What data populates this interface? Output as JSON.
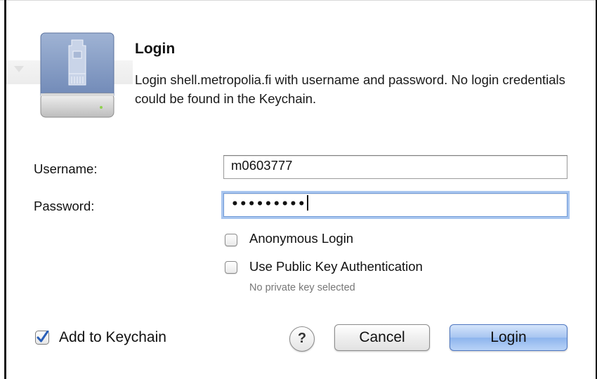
{
  "dialog": {
    "title": "Login",
    "description": "Login shell.metropolia.fi with username and password. No login credentials could be found in the Keychain.",
    "icon": "network-drive-icon"
  },
  "form": {
    "username_label": "Username:",
    "username_value": "m0603777",
    "password_label": "Password:",
    "password_masked": "•••••••••",
    "anonymous_label": "Anonymous Login",
    "anonymous_checked": false,
    "public_key_label": "Use Public Key Authentication",
    "public_key_checked": false,
    "public_key_note": "No private key selected"
  },
  "footer": {
    "keychain_label": "Add to Keychain",
    "keychain_checked": true,
    "help_label": "?",
    "cancel_label": "Cancel",
    "login_label": "Login"
  },
  "colors": {
    "default_button": "#8db4ed",
    "focus_ring": "#a9c6ef",
    "check_mark": "#2a5fb8"
  }
}
